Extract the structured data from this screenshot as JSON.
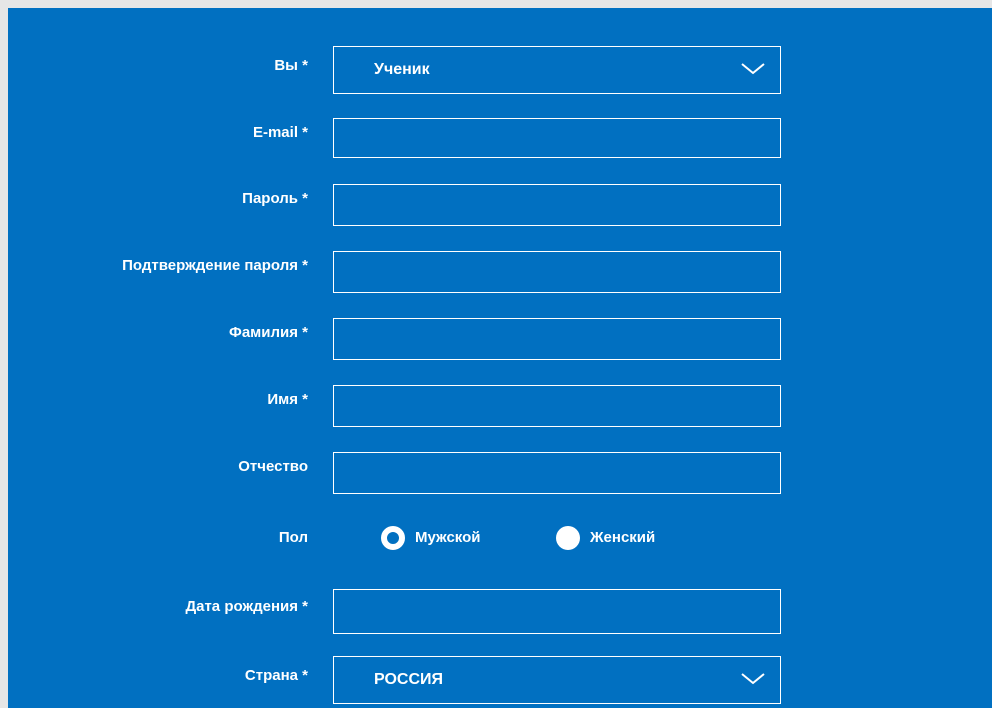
{
  "form": {
    "role": {
      "label": "Вы *",
      "value": "Ученик",
      "icon": "chevron-down-icon"
    },
    "email": {
      "label": "E-mail *",
      "value": ""
    },
    "password": {
      "label": "Пароль *",
      "value": ""
    },
    "password_confirm": {
      "label": "Подтверждение пароля *",
      "value": ""
    },
    "last_name": {
      "label": "Фамилия *",
      "value": ""
    },
    "first_name": {
      "label": "Имя *",
      "value": ""
    },
    "middle_name": {
      "label": "Отчество",
      "value": ""
    },
    "gender": {
      "label": "Пол",
      "options": [
        {
          "label": "Мужской",
          "selected": true
        },
        {
          "label": "Женский",
          "selected": false
        }
      ]
    },
    "birth_date": {
      "label": "Дата рождения *",
      "value": ""
    },
    "country": {
      "label": "Страна *",
      "value": "РОССИЯ",
      "icon": "chevron-down-icon"
    }
  },
  "colors": {
    "panel_background": "#0170c1",
    "page_background": "#e6e6e6",
    "text": "#ffffff",
    "field_border": "#ffffff"
  }
}
